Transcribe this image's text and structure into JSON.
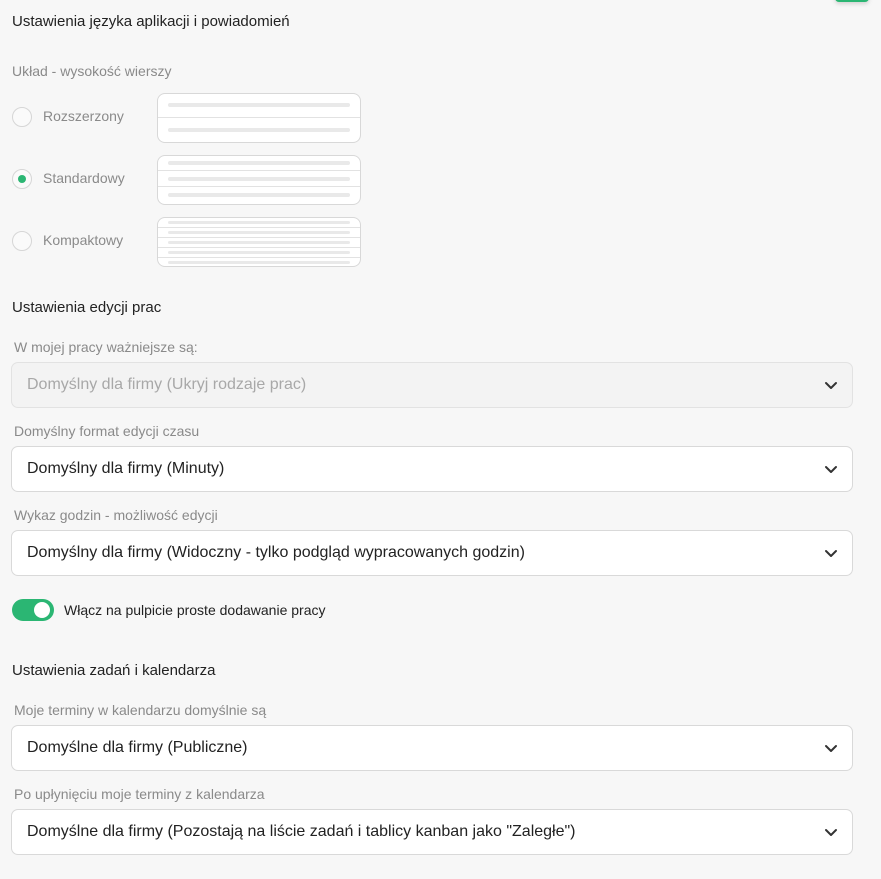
{
  "sections": {
    "language_notifications_title": "Ustawienia języka aplikacji i powiadomień",
    "work_edit_title": "Ustawienia edycji prac",
    "tasks_calendar_title": "Ustawienia zadań i kalendarza"
  },
  "row_height": {
    "label": "Układ - wysokość wierszy",
    "options": [
      {
        "label": "Rozszerzony",
        "checked": false
      },
      {
        "label": "Standardowy",
        "checked": true
      },
      {
        "label": "Kompaktowy",
        "checked": false
      }
    ]
  },
  "work_edit": {
    "important_label": "W mojej pracy ważniejsze są:",
    "important_value": "Domyślny dla firmy (Ukryj rodzaje prac)",
    "time_format_label": "Domyślny format edycji czasu",
    "time_format_value": "Domyślny dla firmy (Minuty)",
    "hours_label": "Wykaz godzin - możliwość edycji",
    "hours_value": "Domyślny dla firmy (Widoczny - tylko podgląd wypracowanych godzin)",
    "toggle_label": "Włącz na pulpicie proste dodawanie pracy",
    "toggle_on": true
  },
  "tasks_calendar": {
    "visibility_label": "Moje terminy w kalendarzu domyślnie są",
    "visibility_value": "Domyślne dla firmy (Publiczne)",
    "expiry_label": "Po upłynięciu moje terminy z kalendarza",
    "expiry_value": "Domyślne dla firmy (Pozostają na liście zadań i tablicy kanban jako \"Zaległe\")"
  },
  "colors": {
    "accent": "#2bb673"
  }
}
